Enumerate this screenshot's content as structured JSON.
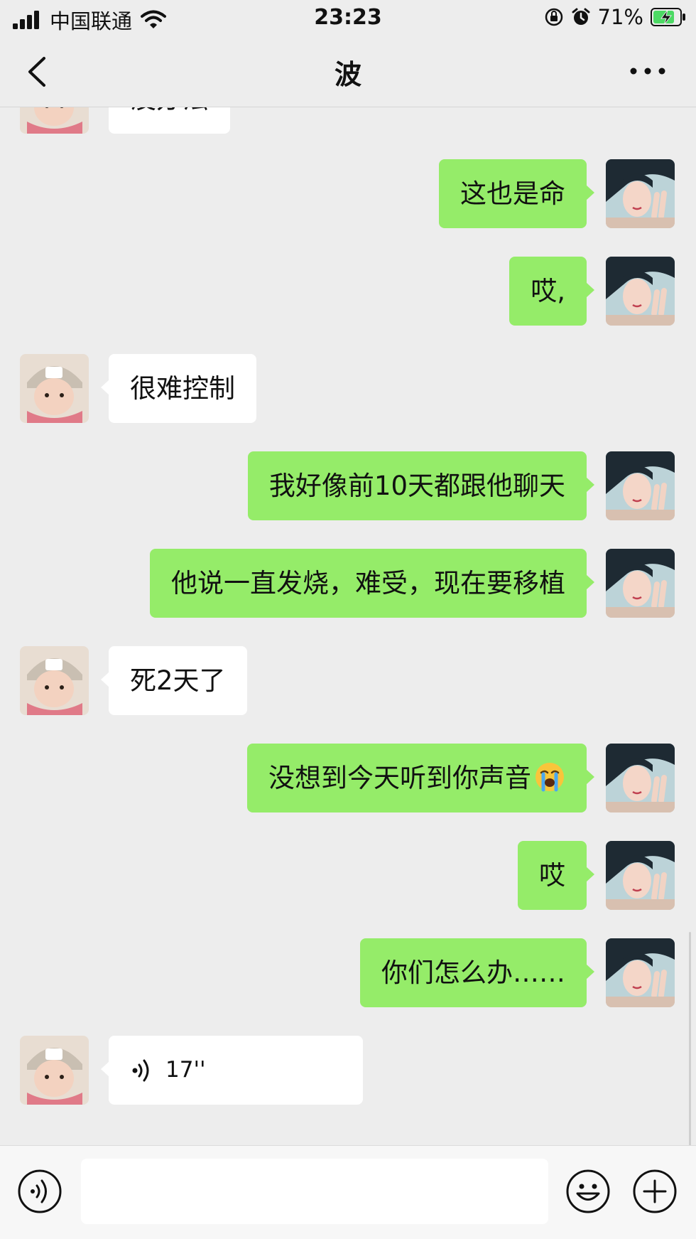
{
  "status_bar": {
    "carrier": "中国联通",
    "time": "23:23",
    "battery": "71%"
  },
  "nav": {
    "title": "波"
  },
  "messages": [
    {
      "side": "in",
      "text": "没办法"
    },
    {
      "side": "out",
      "text": "这也是命"
    },
    {
      "side": "out",
      "text": "哎,"
    },
    {
      "side": "in",
      "text": "很难控制"
    },
    {
      "side": "out",
      "text": "我好像前10天都跟他聊天"
    },
    {
      "side": "out",
      "text": "他说一直发烧，难受，现在要移植"
    },
    {
      "side": "in",
      "text": "死2天了"
    },
    {
      "side": "out",
      "text": "没想到今天听到你声音",
      "emoji": "loudly-crying-face"
    },
    {
      "side": "out",
      "text": "哎"
    },
    {
      "side": "out",
      "text": "你们怎么办……"
    },
    {
      "side": "in",
      "type": "voice",
      "duration": "17''"
    }
  ],
  "colors": {
    "background": "#ededed",
    "outgoing_bubble": "#95ec69",
    "incoming_bubble": "#ffffff"
  },
  "input_bar": {
    "voice_button_icon": "voice-input-icon",
    "emoji_button_icon": "smiley-icon",
    "more_button_icon": "plus-icon"
  }
}
